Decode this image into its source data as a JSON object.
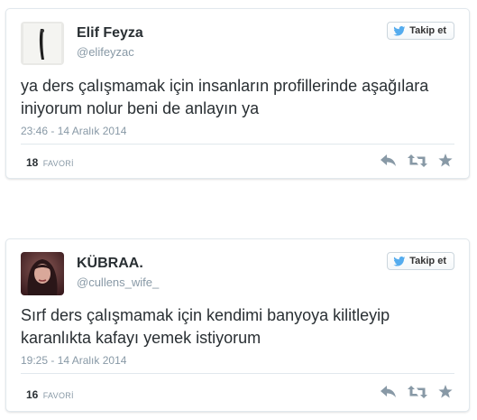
{
  "colors": {
    "accent": "#55acee",
    "text": "#292f33",
    "muted": "#8899a6",
    "border": "#e1e8ed",
    "action_icon": "#8899a6"
  },
  "tweets": [
    {
      "name": "Elif Feyza",
      "handle": "@elifeyzac",
      "follow_label": "Takip et",
      "text": "ya ders çalışmamak için insanların profillerinde aşağılara iniyorum nolur beni de anlayın ya",
      "time": "23:46 - 14 Aralık 2014",
      "fav_count": "18",
      "fav_label": "FAVORİ",
      "icons": [
        "reply-icon",
        "retweet-icon",
        "favorite-icon"
      ]
    },
    {
      "name": "KÜBRAA.",
      "handle": "@cullens_wife_",
      "follow_label": "Takip et",
      "text": "Sırf ders çalışmamak için kendimi banyoya kilitleyip karanlıkta kafayı yemek istiyorum",
      "time": "19:25 - 14 Aralık 2014",
      "fav_count": "16",
      "fav_label": "FAVORİ",
      "icons": [
        "reply-icon",
        "retweet-icon",
        "favorite-icon"
      ]
    }
  ]
}
